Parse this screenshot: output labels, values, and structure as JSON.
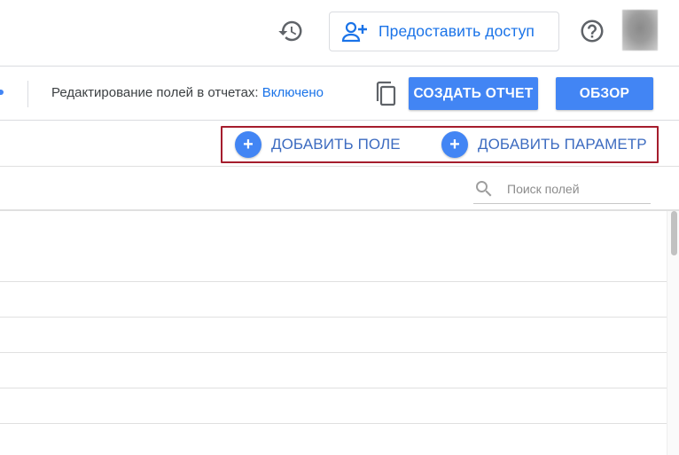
{
  "header": {
    "share_label": "Предоставить доступ",
    "icons": [
      "history-icon",
      "person-add-icon",
      "help-icon"
    ]
  },
  "toolbar": {
    "edit_label": "Редактирование полей в отчетах: ",
    "edit_value": "Включено",
    "create_report_label": "СОЗДАТЬ ОТЧЕТ",
    "review_label": "ОБЗОР",
    "icons": [
      "copy-icon"
    ]
  },
  "actions": {
    "add_field_label": "ДОБАВИТЬ ПОЛЕ",
    "add_param_label": "ДОБАВИТЬ ПАРАМЕТР",
    "plus_glyph": "+"
  },
  "search": {
    "placeholder": "Поиск полей",
    "value": ""
  },
  "colors": {
    "accent": "#4285f4",
    "link": "#1a73e8",
    "highlight_border": "#a51d2d"
  }
}
